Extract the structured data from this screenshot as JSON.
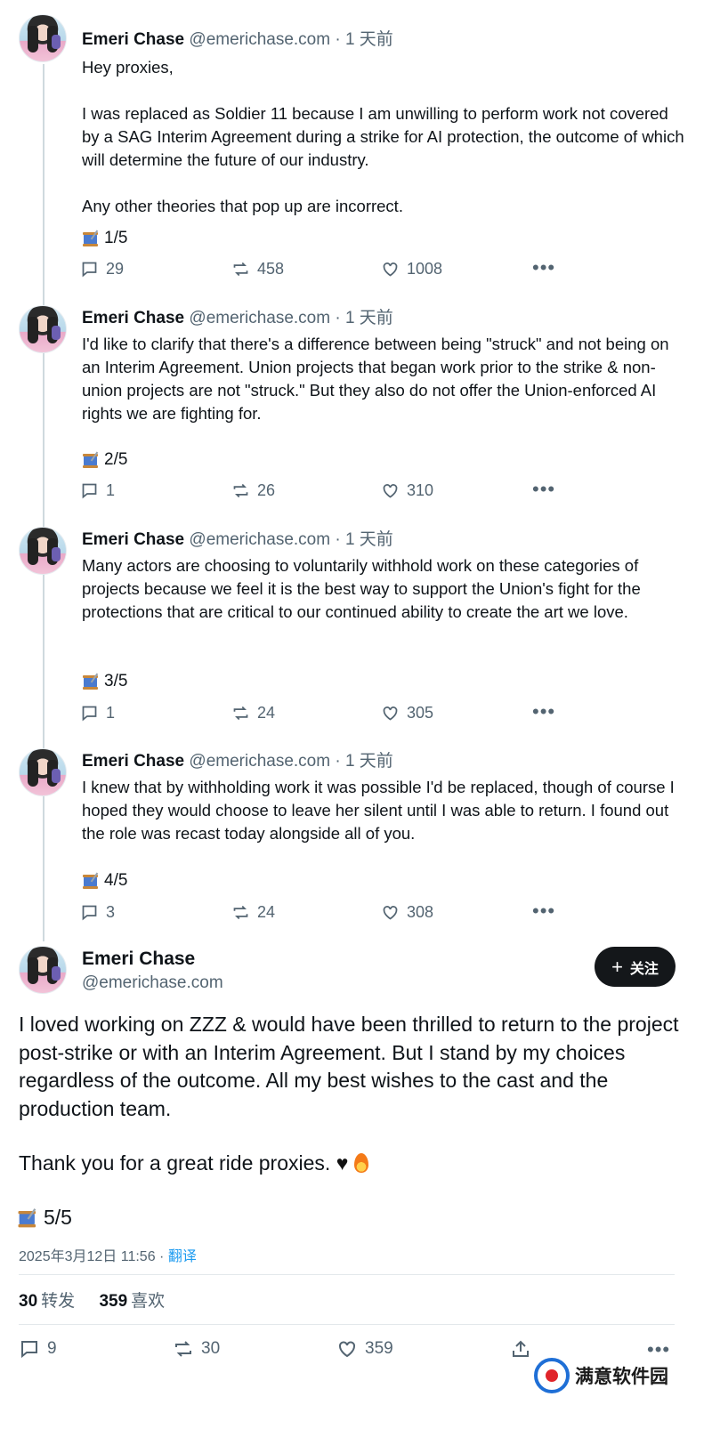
{
  "thread": [
    {
      "name": "Emeri Chase",
      "handle": "@emerichase.com",
      "time": "· 1 天前",
      "paragraphs": [
        "Hey proxies,",
        "I was replaced as Soldier 11 because I am unwilling to perform work not covered by a SAG Interim Agreement during a strike for AI protection, the outcome of which will determine the future of our industry.",
        "Any other theories that pop up are incorrect."
      ],
      "count": "1/5",
      "replies": "29",
      "reposts": "458",
      "likes": "1008"
    },
    {
      "name": "Emeri Chase",
      "handle": "@emerichase.com",
      "time": "· 1 天前",
      "paragraphs": [
        "I'd like to clarify that there's a difference between being \"struck\" and not being on an Interim Agreement. Union projects that began work prior to the strike & non-union projects are not \"struck.\" But they also do not offer the Union-enforced AI rights we are fighting for."
      ],
      "count": "2/5",
      "replies": "1",
      "reposts": "26",
      "likes": "310"
    },
    {
      "name": "Emeri Chase",
      "handle": "@emerichase.com",
      "time": "· 1 天前",
      "paragraphs": [
        "Many actors are choosing to voluntarily withhold work on these categories of projects because we feel it is the best way to support the Union's fight for the protections that are critical to our continued ability to create the art we love."
      ],
      "count": "3/5",
      "replies": "1",
      "reposts": "24",
      "likes": "305"
    },
    {
      "name": "Emeri Chase",
      "handle": "@emerichase.com",
      "time": "· 1 天前",
      "paragraphs": [
        "I knew that by withholding work it was possible I'd be replaced, though of course I hoped they would choose to leave her silent until I was able to return. I found out the role was recast today alongside all of you."
      ],
      "count": "4/5",
      "replies": "3",
      "reposts": "24",
      "likes": "308"
    }
  ],
  "main": {
    "name": "Emeri Chase",
    "handle": "@emerichase.com",
    "follow_label": "关注",
    "paragraph1": "I loved working on ZZZ & would have been thrilled to return to the project post-strike or with an Interim Agreement. But I stand by my choices regardless of the outcome. All my best wishes to the cast and the production team.",
    "paragraph2": "Thank you for a great ride proxies.",
    "count": "5/5",
    "timestamp": "2025年3月12日 11:56",
    "translate": "翻译",
    "reposts_num": "30",
    "reposts_label": "转发",
    "likes_num": "359",
    "likes_label": "喜欢",
    "replies": "9",
    "reposts": "30",
    "likes": "359"
  },
  "watermark": "满意软件园",
  "colors": {
    "text": "#0f1419",
    "muted": "#536471",
    "link": "#1d9bf0",
    "follow_bg": "#14171a",
    "thread_line": "#cfd9de"
  },
  "icons": [
    "reply-icon",
    "repost-icon",
    "like-icon",
    "more-icon",
    "thread-emoji-icon",
    "share-icon",
    "plus-icon"
  ]
}
